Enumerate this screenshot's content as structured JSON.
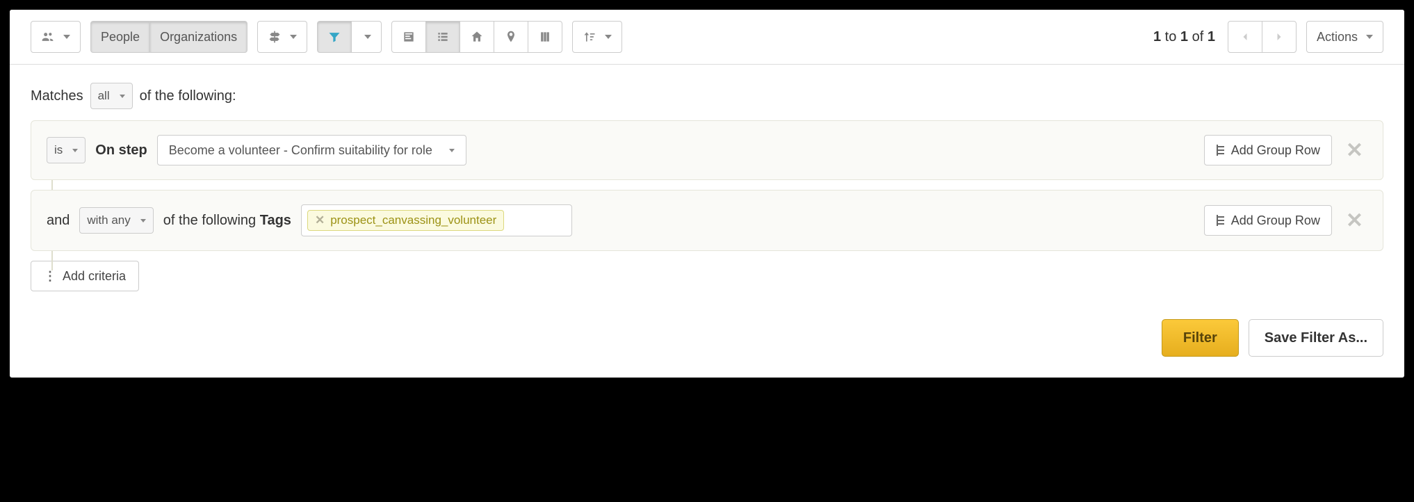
{
  "toolbar": {
    "people_tab": "People",
    "orgs_tab": "Organizations",
    "actions_label": "Actions"
  },
  "pager": {
    "from": "1",
    "to": "1",
    "of": "1",
    "of_word": "of",
    "to_word": "to"
  },
  "filter": {
    "matches_prefix": "Matches",
    "matches_mode": "all",
    "matches_suffix": "of the following:",
    "row1": {
      "condition": "is",
      "label": "On step",
      "value": "Become a volunteer - Confirm suitability for role",
      "add_group": "Add Group Row"
    },
    "row2": {
      "conjunction": "and",
      "mode": "with any",
      "label": "of the following",
      "label_bold": "Tags",
      "tag": "prospect_canvassing_volunteer",
      "add_group": "Add Group Row"
    },
    "add_criteria": "Add criteria",
    "filter_btn": "Filter",
    "save_as_btn": "Save Filter As..."
  }
}
